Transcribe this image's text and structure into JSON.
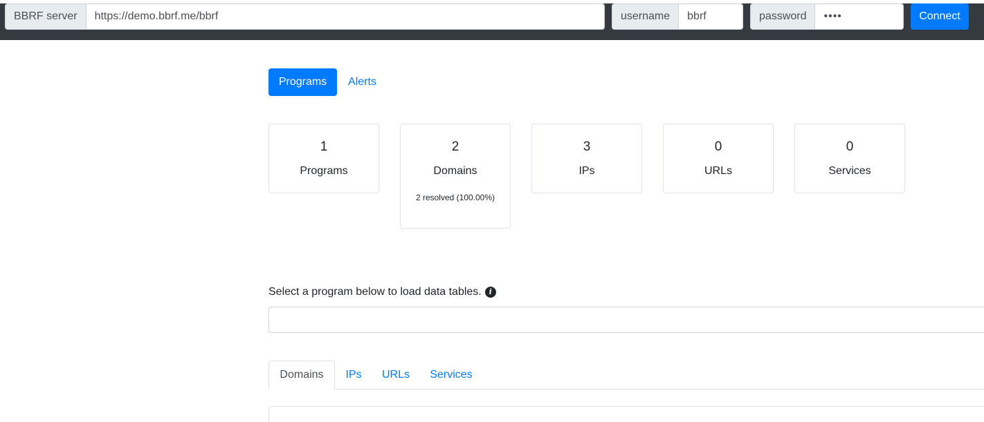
{
  "topbar": {
    "server_label": "BBRF server",
    "server_value": "https://demo.bbrf.me/bbrf",
    "username_label": "username",
    "username_value": "bbrf",
    "password_label": "password",
    "password_value": "••••",
    "connect_label": "Connect"
  },
  "nav": {
    "pills": [
      {
        "label": "Programs",
        "active": true
      },
      {
        "label": "Alerts",
        "active": false
      }
    ]
  },
  "stats": [
    {
      "value": "1",
      "label": "Programs"
    },
    {
      "value": "2",
      "label": "Domains",
      "sub": "2 resolved (100.00%)"
    },
    {
      "value": "3",
      "label": "IPs"
    },
    {
      "value": "0",
      "label": "URLs"
    },
    {
      "value": "0",
      "label": "Services"
    }
  ],
  "program_select": {
    "label": "Select a program below to load data tables.",
    "info_icon": "info-circle-icon",
    "value": ""
  },
  "data_tabs": [
    {
      "label": "Domains",
      "active": true
    },
    {
      "label": "IPs",
      "active": false
    },
    {
      "label": "URLs",
      "active": false
    },
    {
      "label": "Services",
      "active": false
    }
  ],
  "colors": {
    "topbar": "#343a40",
    "primary": "#007bff",
    "addon_bg": "#e9ecef",
    "border": "#ced4da"
  }
}
